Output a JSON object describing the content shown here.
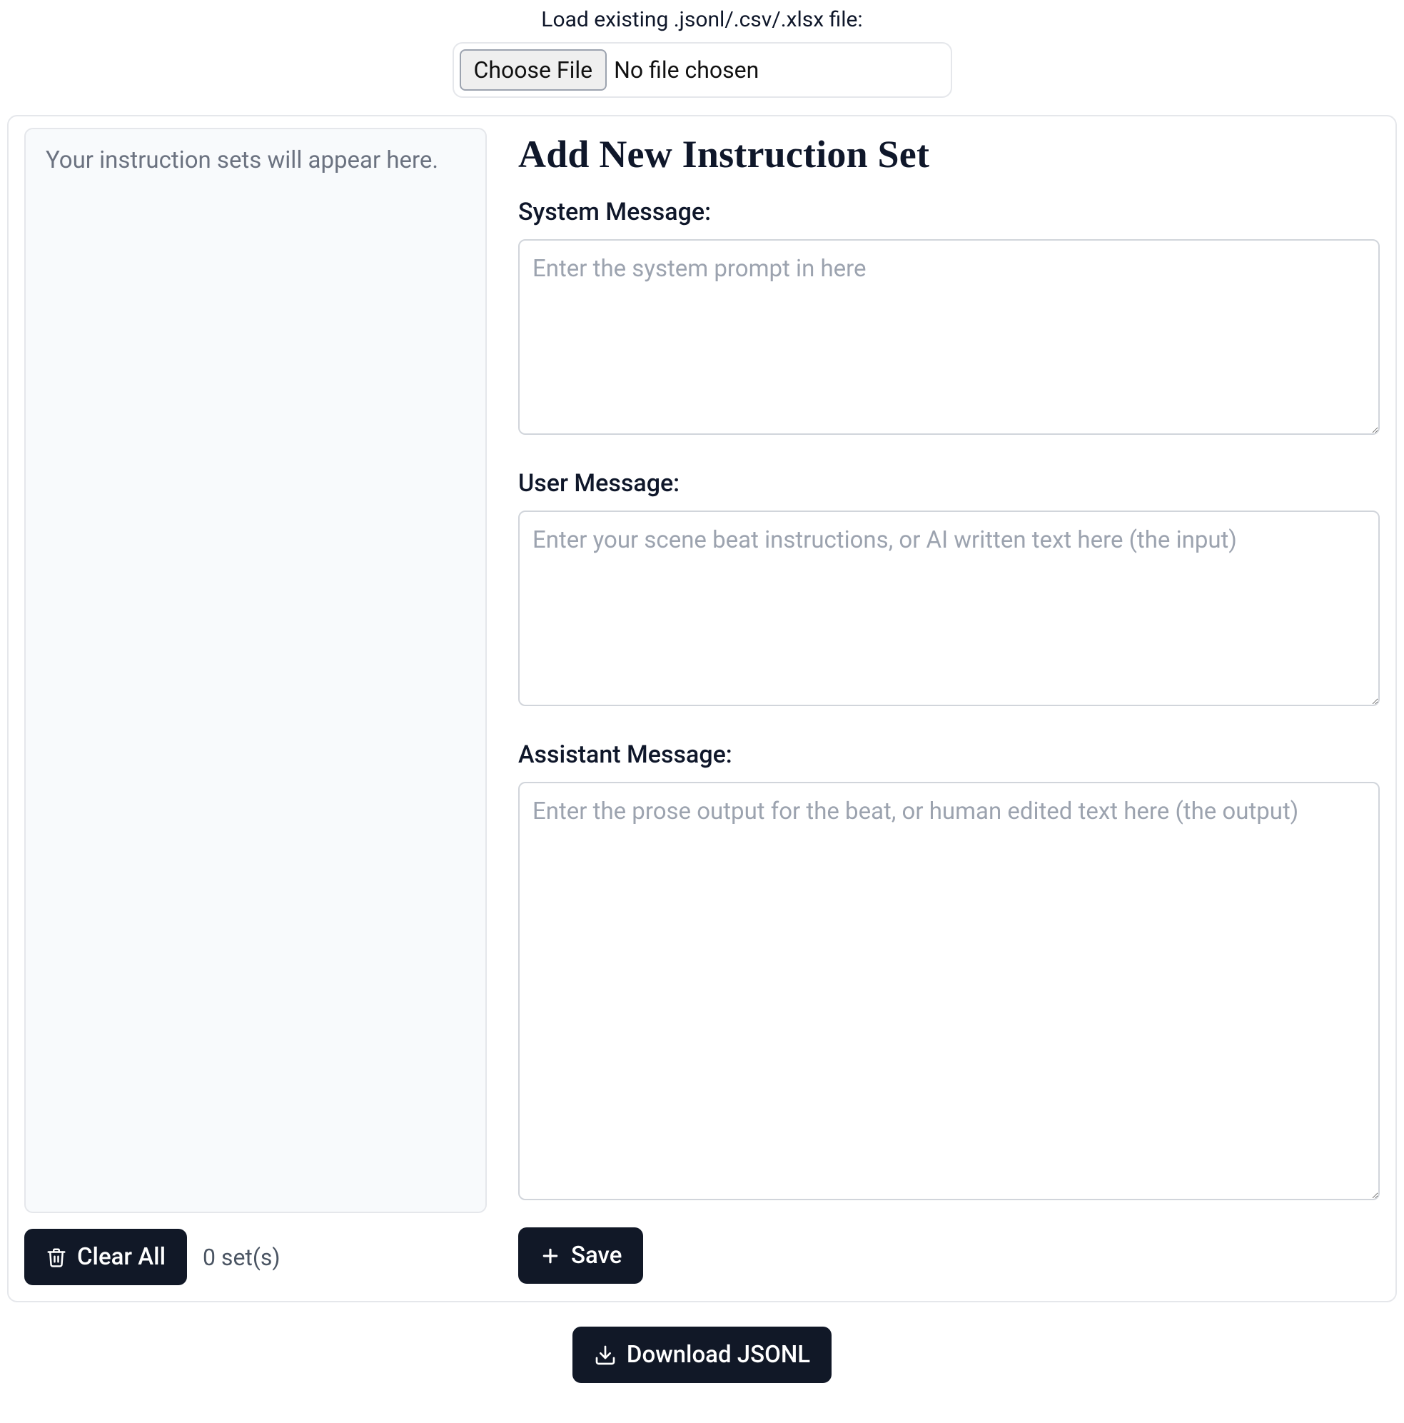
{
  "loader": {
    "label": "Load existing .jsonl/.csv/.xlsx file:",
    "choose_button": "Choose File",
    "status": "No file chosen"
  },
  "sidebar": {
    "empty_message": "Your instruction sets will appear here.",
    "clear_button": "Clear All",
    "count_text": "0 set(s)"
  },
  "form": {
    "heading": "Add New Instruction Set",
    "system": {
      "label": "System Message:",
      "placeholder": "Enter the system prompt in here",
      "value": ""
    },
    "user": {
      "label": "User Message:",
      "placeholder": "Enter your scene beat instructions, or AI written text here (the input)",
      "value": ""
    },
    "assistant": {
      "label": "Assistant Message:",
      "placeholder": "Enter the prose output for the beat, or human edited text here (the output)",
      "value": ""
    },
    "save_button": "Save"
  },
  "download": {
    "button": "Download JSONL"
  }
}
